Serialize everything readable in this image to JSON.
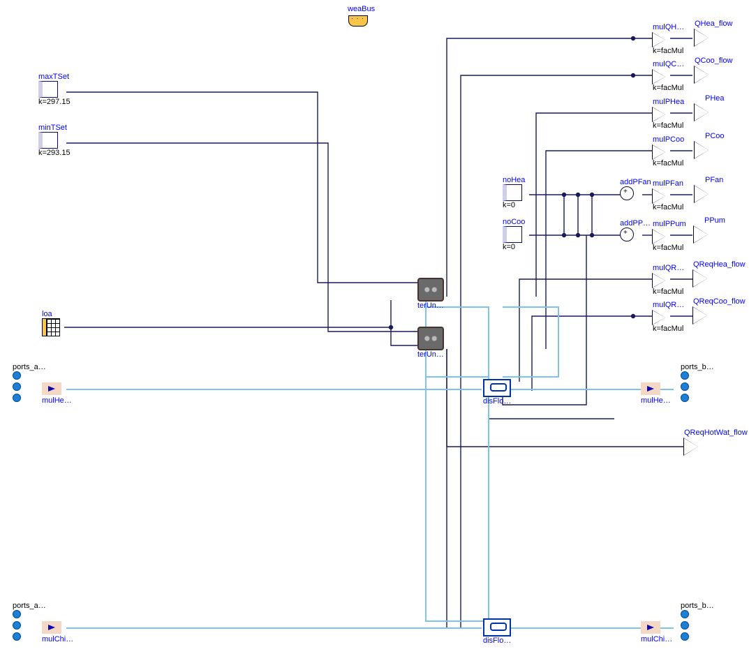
{
  "bus": {
    "label": "weaBus"
  },
  "consts": {
    "maxTSet": {
      "label": "maxTSet",
      "k": "k=297.15"
    },
    "minTSet": {
      "label": "minTSet",
      "k": "k=293.15"
    },
    "noHea": {
      "label": "noHea",
      "k": "k=0"
    },
    "noCoo": {
      "label": "noCoo",
      "k": "k=0"
    }
  },
  "loa": {
    "label": "loa"
  },
  "gains": {
    "mulQH": {
      "label": "mulQH…",
      "k": "k=facMul"
    },
    "mulQC": {
      "label": "mulQC…",
      "k": "k=facMul"
    },
    "mulPHea": {
      "label": "mulPHea",
      "k": "k=facMul"
    },
    "mulPCoo": {
      "label": "mulPCoo",
      "k": "k=facMul"
    },
    "mulPFan": {
      "label": "mulPFan",
      "k": "k=facMul"
    },
    "mulPPum": {
      "label": "mulPPum",
      "k": "k=facMul"
    },
    "mulQR1": {
      "label": "mulQR…",
      "k": "k=facMul"
    },
    "mulQR2": {
      "label": "mulQR…",
      "k": "k=facMul"
    }
  },
  "adders": {
    "addPFan": {
      "label": "addPFan"
    },
    "addPP": {
      "label": "addPP…"
    }
  },
  "outputs": {
    "QHea_flow": "QHea_flow",
    "QCoo_flow": "QCoo_flow",
    "PHea": "PHea",
    "PCoo": "PCoo",
    "PFan": "PFan",
    "PPum": "PPum",
    "QReqHea_flow": "QReqHea_flow",
    "QReqCoo_flow": "QReqCoo_flow",
    "QReqHotWat_flow": "QReqHotWat_flow"
  },
  "ter": {
    "ter1": "terUn…",
    "ter2": "terUn…"
  },
  "dis": {
    "dis1": "disFlo…",
    "dis2": "disFlo…"
  },
  "ports": {
    "a1": "ports_a…",
    "b1": "ports_b…",
    "a2": "ports_a…",
    "b2": "ports_b…"
  },
  "mulFlow": {
    "mulHeIn": "mulHe…",
    "mulHeOut": "mulHe…",
    "mulChIn": "mulChi…",
    "mulChOut": "mulChi…"
  }
}
